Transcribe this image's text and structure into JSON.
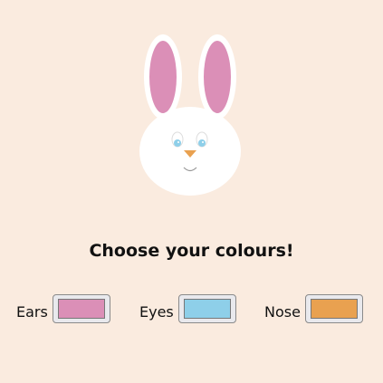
{
  "heading": "Choose your colours!",
  "pickers": [
    {
      "label": "Ears",
      "value": "#db8fb7"
    },
    {
      "label": "Eyes",
      "value": "#8ecfe9"
    },
    {
      "label": "Nose",
      "value": "#e9a150"
    }
  ],
  "colors": {
    "background": "#faebdf",
    "bunny_fur": "#ffffff",
    "mouth_line": "#999999",
    "pupil": "#ffffff"
  }
}
